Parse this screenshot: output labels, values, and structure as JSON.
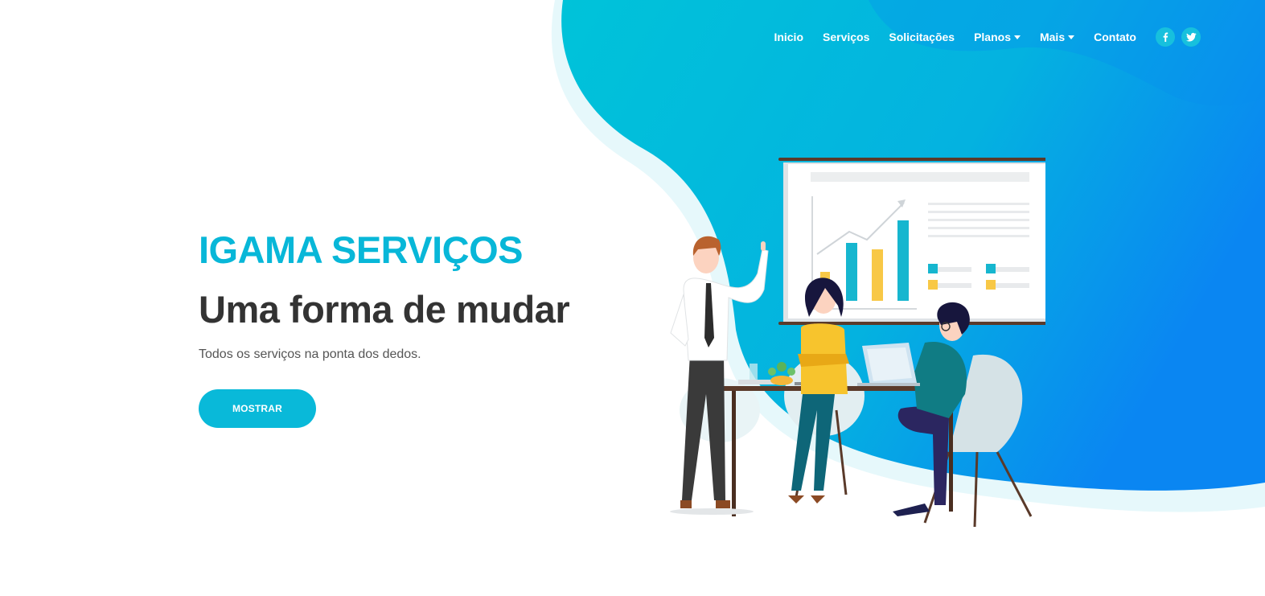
{
  "nav": {
    "items": [
      {
        "label": "Inicio",
        "dropdown": false
      },
      {
        "label": "Serviços",
        "dropdown": false
      },
      {
        "label": "Solicitações",
        "dropdown": false
      },
      {
        "label": "Planos",
        "dropdown": true
      },
      {
        "label": "Mais",
        "dropdown": true
      },
      {
        "label": "Contato",
        "dropdown": false
      }
    ],
    "social": [
      {
        "icon": "facebook-icon",
        "glyph": "f"
      },
      {
        "icon": "twitter-icon",
        "glyph": "t"
      }
    ]
  },
  "hero": {
    "brand": "IGAMA SERVIÇOS",
    "headline": "Uma forma de mudar",
    "tagline": "Todos os serviços na ponta dos dedos.",
    "cta_label": "MOSTRAR"
  },
  "colors": {
    "accent": "#09b9d9",
    "brand_text": "#08b7d8",
    "headline_text": "#333333",
    "gradient_start": "#00c3d9",
    "gradient_end": "#0a86f2"
  }
}
